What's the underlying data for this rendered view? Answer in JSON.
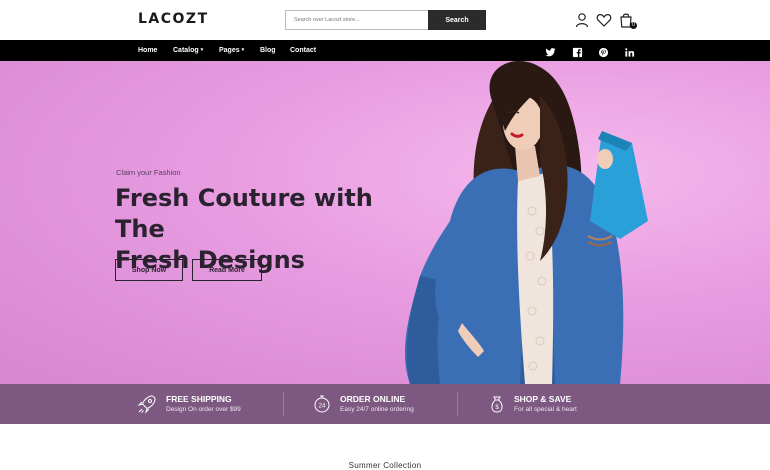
{
  "header": {
    "logo": "LACOZT",
    "search": {
      "placeholder": "Search over Lacozt store...",
      "button_label": "Search"
    },
    "icons": [
      "user-icon",
      "heart-icon",
      "cart-icon"
    ],
    "cart_count": "0"
  },
  "nav": {
    "items": [
      {
        "label": "Home",
        "dropdown": false
      },
      {
        "label": "Catalog",
        "dropdown": true
      },
      {
        "label": "Pages",
        "dropdown": true
      },
      {
        "label": "Blog",
        "dropdown": false
      },
      {
        "label": "Contact",
        "dropdown": false
      }
    ],
    "caret": "▾",
    "social": [
      "twitter-icon",
      "facebook-icon",
      "pinterest-icon",
      "linkedin-icon"
    ]
  },
  "hero": {
    "overline": "Claim your Fashion",
    "title_line1": "Fresh Couture with The",
    "title_line2": "Fresh Designs",
    "buttons": [
      "Shop Now",
      "Read More"
    ]
  },
  "features": [
    {
      "icon": "rocket-icon",
      "title": "FREE SHIPPING",
      "subtitle": "Design On order over $99"
    },
    {
      "icon": "clock-24-icon",
      "title": "ORDER ONLINE",
      "subtitle": "Easy 24/7 online ordering"
    },
    {
      "icon": "money-bag-icon",
      "title": "SHOP & SAVE",
      "subtitle": "For all special & heart"
    }
  ],
  "section_title": "Summer Collection",
  "colors": {
    "nav_bg": "#000000",
    "hero_bg": "#e79be0",
    "features_bg": "#7d5880",
    "accent_dark": "#2b2230",
    "coat": "#3b6fb5",
    "clutch": "#2aa0d8"
  }
}
